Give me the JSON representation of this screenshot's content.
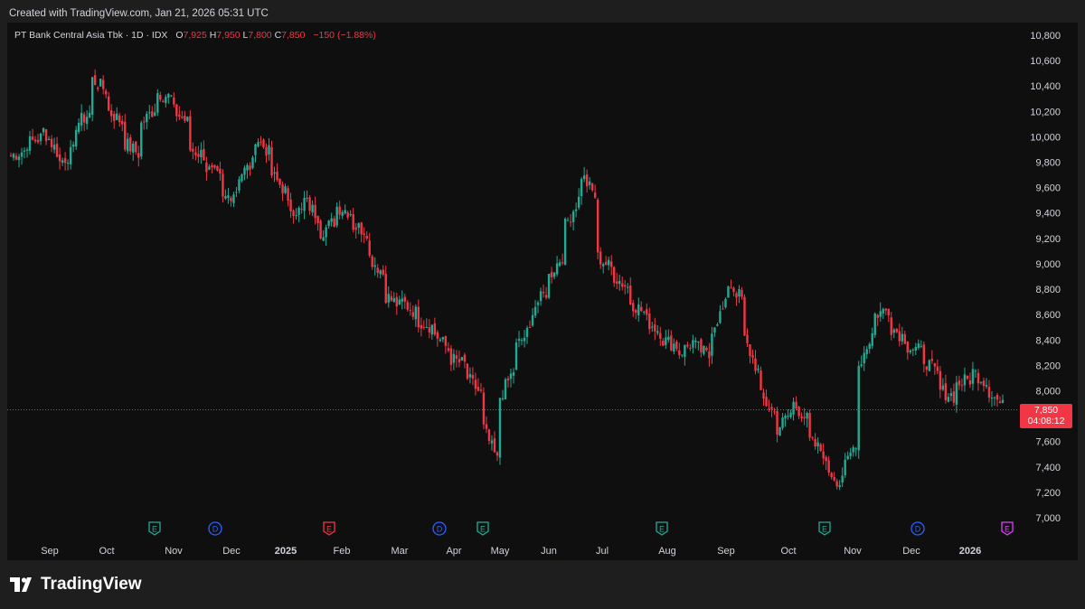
{
  "caption": "Created with TradingView.com, Jan 21, 2026 05:31 UTC",
  "symbol": {
    "name": "PT Bank Central Asia Tbk · 1D · IDX",
    "open_label": "O",
    "open": "7,925",
    "high_label": "H",
    "high": "7,950",
    "low_label": "L",
    "low": "7,800",
    "close_label": "C",
    "close": "7,850",
    "change": "−150 (−1.88%)"
  },
  "last_price": {
    "price": "7,850",
    "countdown": "04:08:12"
  },
  "brand": "TradingView",
  "colors": {
    "up": "#22ab94",
    "down": "#f23645",
    "background": "#0f0f0f",
    "dividends": "#2962ff",
    "earnings_future": "#e040fb"
  },
  "chart_data": {
    "type": "candlestick",
    "y_ticks": [
      "10,800",
      "10,600",
      "10,400",
      "10,200",
      "10,000",
      "9,800",
      "9,600",
      "9,400",
      "9,200",
      "9,000",
      "8,800",
      "8,600",
      "8,400",
      "8,200",
      "8,000",
      "7,800",
      "7,600",
      "7,400",
      "7,200",
      "7,000"
    ],
    "ylim": [
      7000,
      10800
    ],
    "x_ticks": [
      {
        "label": "Sep",
        "bold": false
      },
      {
        "label": "Oct",
        "bold": false
      },
      {
        "label": "Nov",
        "bold": false
      },
      {
        "label": "Dec",
        "bold": false
      },
      {
        "label": "2025",
        "bold": true
      },
      {
        "label": "Feb",
        "bold": false
      },
      {
        "label": "Mar",
        "bold": false
      },
      {
        "label": "Apr",
        "bold": false
      },
      {
        "label": "May",
        "bold": false
      },
      {
        "label": "Jun",
        "bold": false
      },
      {
        "label": "Jul",
        "bold": false
      },
      {
        "label": "Aug",
        "bold": false
      },
      {
        "label": "Sep",
        "bold": false
      },
      {
        "label": "Oct",
        "bold": false
      },
      {
        "label": "Nov",
        "bold": false
      },
      {
        "label": "Dec",
        "bold": false
      },
      {
        "label": "2026",
        "bold": true
      }
    ],
    "events": [
      {
        "type": "E",
        "kind": "earnings-past-up"
      },
      {
        "type": "D",
        "kind": "dividend"
      },
      {
        "type": "E",
        "kind": "earnings-past-down"
      },
      {
        "type": "D",
        "kind": "dividend"
      },
      {
        "type": "E",
        "kind": "earnings-past-up"
      },
      {
        "type": "E",
        "kind": "earnings-past-up"
      },
      {
        "type": "E",
        "kind": "earnings-past-up"
      },
      {
        "type": "D",
        "kind": "dividend"
      },
      {
        "type": "E",
        "kind": "earnings-future"
      }
    ],
    "price_path": [
      [
        9850,
        9900
      ],
      [
        9950,
        10000
      ],
      [
        10050,
        9850
      ],
      [
        9800,
        9900
      ],
      [
        10100,
        10200
      ],
      [
        10450,
        10350
      ],
      [
        10200,
        10100
      ],
      [
        9950,
        9850
      ],
      [
        10100,
        10250
      ],
      [
        10350,
        10300
      ],
      [
        10200,
        10100
      ],
      [
        9900,
        9850
      ],
      [
        9750,
        9650
      ],
      [
        9500,
        9600
      ],
      [
        9700,
        9800
      ],
      [
        10000,
        9850
      ],
      [
        9700,
        9550
      ],
      [
        9450,
        9400
      ],
      [
        9500,
        9350
      ],
      [
        9250,
        9350
      ],
      [
        9450,
        9400
      ],
      [
        9300,
        9250
      ],
      [
        9050,
        8900
      ],
      [
        8750,
        8650
      ],
      [
        8700,
        8600
      ],
      [
        8550,
        8500
      ],
      [
        8450,
        8300
      ],
      [
        8250,
        8200
      ],
      [
        8100,
        7950
      ],
      [
        7700,
        7400
      ],
      [
        7950,
        8200
      ],
      [
        8350,
        8500
      ],
      [
        8650,
        8800
      ],
      [
        8900,
        9100
      ],
      [
        9300,
        9550
      ],
      [
        9700,
        9500
      ],
      [
        9050,
        8950
      ],
      [
        8900,
        8800
      ],
      [
        8700,
        8600
      ],
      [
        8550,
        8450
      ],
      [
        8400,
        8350
      ],
      [
        8300,
        8400
      ],
      [
        8350,
        8250
      ],
      [
        8500,
        8700
      ],
      [
        8850,
        8700
      ],
      [
        8400,
        8100
      ],
      [
        7950,
        7800
      ],
      [
        7700,
        7850
      ],
      [
        7900,
        7750
      ],
      [
        7600,
        7500
      ],
      [
        7400,
        7250
      ],
      [
        7350,
        7650
      ],
      [
        8200,
        8500
      ],
      [
        8600,
        8650
      ],
      [
        8500,
        8400
      ],
      [
        8350,
        8300
      ],
      [
        8250,
        8100
      ],
      [
        8000,
        7950
      ],
      [
        8050,
        8100
      ],
      [
        8150,
        8050
      ],
      [
        8000,
        7850
      ]
    ]
  }
}
